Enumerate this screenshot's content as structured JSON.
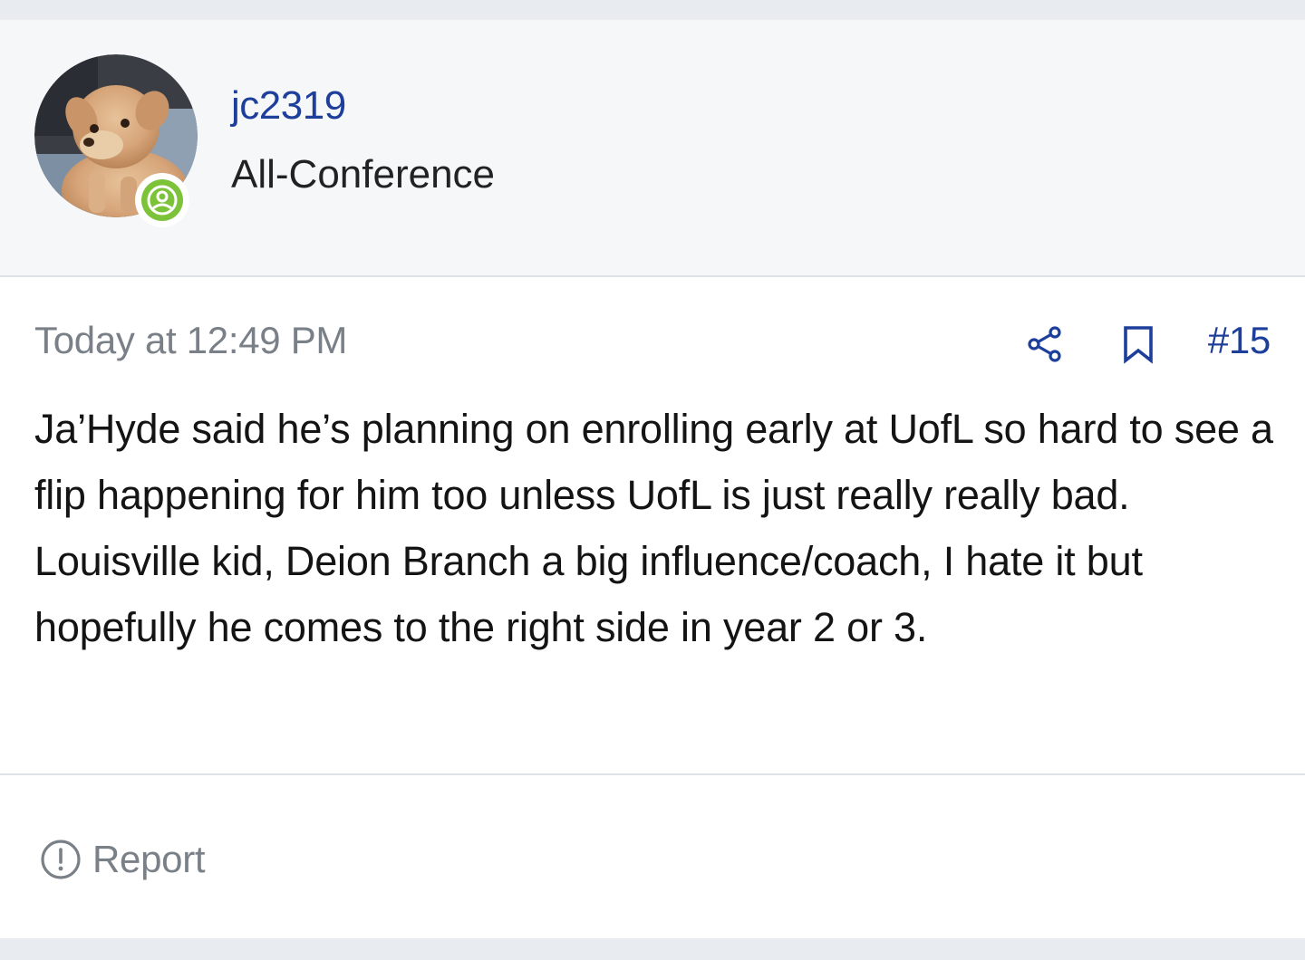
{
  "post": {
    "author": {
      "username": "jc2319",
      "title": "All-Conference",
      "avatar_icon": "dog-photo-avatar",
      "online_status_icon": "online-user-icon",
      "online_color": "#7cc33a"
    },
    "meta": {
      "timestamp": "Today at 12:49 PM",
      "share_icon": "share-icon",
      "bookmark_icon": "bookmark-icon",
      "post_number": "#15"
    },
    "message": "Ja’Hyde said he’s planning on enrolling early at UofL so hard to see a flip happening for him too unless UofL is just really really bad. Louisville kid, Deion Branch a big influence/coach, I hate it but hopefully he comes to the right side in year 2 or 3.",
    "actions": {
      "report_icon": "alert-circle-icon",
      "report_label": "Report"
    }
  },
  "colors": {
    "link": "#1d3f9b",
    "muted": "#7a8088",
    "text": "#141414",
    "header_bg": "#f6f7f8",
    "page_bg": "#e8ebef"
  }
}
